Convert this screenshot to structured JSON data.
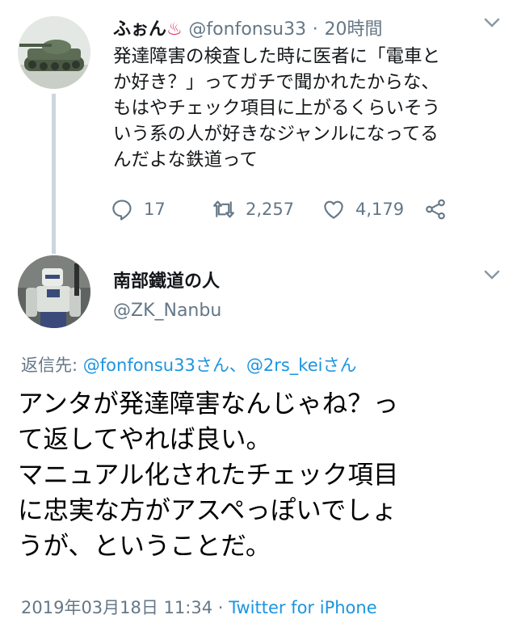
{
  "tweet1": {
    "name": "ふぉん",
    "name_emoji": "♨",
    "handle": "@fonfonsu33",
    "separator": "·",
    "time": "20時間",
    "text": "発達障害の検査した時に医者に「電車と\nか好き？」ってガチで聞かれたからな、\nもはやチェック項目に上がるくらいそう\nいう系の人が好きなジャンルになってる\nんだよな鉄道って",
    "reply_count": "17",
    "retweet_count": "2,257",
    "like_count": "4,179"
  },
  "tweet2": {
    "name": "南部鐵道の人",
    "handle": "@ZK_Nanbu",
    "replying_prefix": "返信先: ",
    "replying_to_1": "@fonfonsu33さん",
    "replying_sep": "、",
    "replying_to_2": "@2rs_keiさん",
    "text": "アンタが発達障害なんじゃね？っ\nて返してやれば良い。\nマニュアル化されたチェック項目\nに忠実な方がアスペっぽいでしょ\nうが、ということだ。",
    "timestamp": "2019年03月18日 11:34",
    "footer_sep": " · ",
    "source": "Twitter for iPhone"
  },
  "colors": {
    "accent": "#1b95e0",
    "secondary_text": "#657786",
    "thread_line": "#ccd6dd",
    "hotspring_emoji": "#e0245e"
  },
  "icons": [
    "tank-avatar",
    "robot-avatar",
    "reply-icon",
    "retweet-icon",
    "like-icon",
    "share-icon",
    "chevron-down-icon"
  ]
}
